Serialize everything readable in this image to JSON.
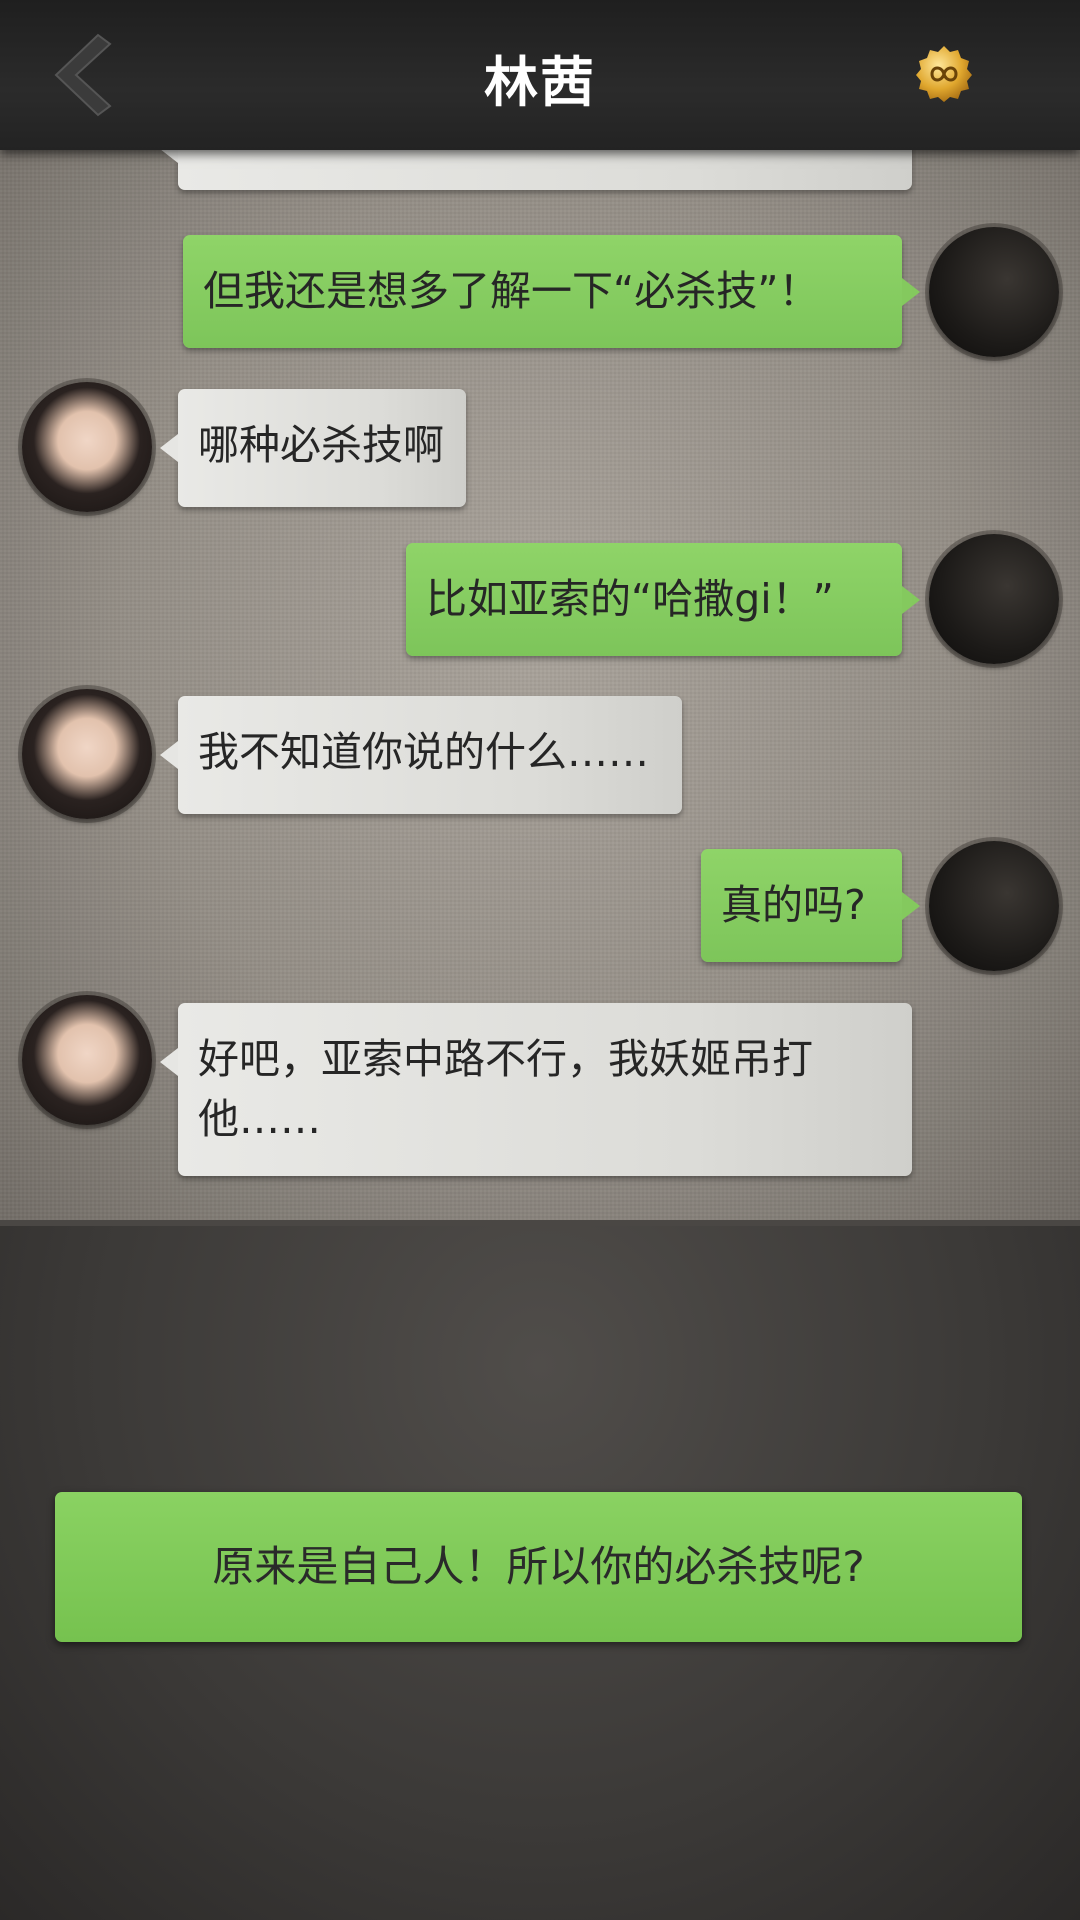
{
  "header": {
    "title": "林茜",
    "back_icon": "chevron-left-icon",
    "coin_icon": "infinity-coin-icon"
  },
  "chat": {
    "messages": [
      {
        "sender": "self",
        "text": "但我还是想多了解一下“必杀技”！"
      },
      {
        "sender": "her",
        "text": "哪种必杀技啊"
      },
      {
        "sender": "self",
        "text": "比如亚索的“哈撒gi！”"
      },
      {
        "sender": "her",
        "text": "我不知道你说的什么……"
      },
      {
        "sender": "self",
        "text": "真的吗?"
      },
      {
        "sender": "her",
        "text": "好吧，亚索中路不行，我妖姬吊打他……"
      }
    ]
  },
  "reply": {
    "option": "原来是自己人！所以你的必杀技呢?"
  },
  "colors": {
    "green_bubble": "#84c95e",
    "white_bubble": "#e6e6e3",
    "header_bg": "#262626"
  }
}
